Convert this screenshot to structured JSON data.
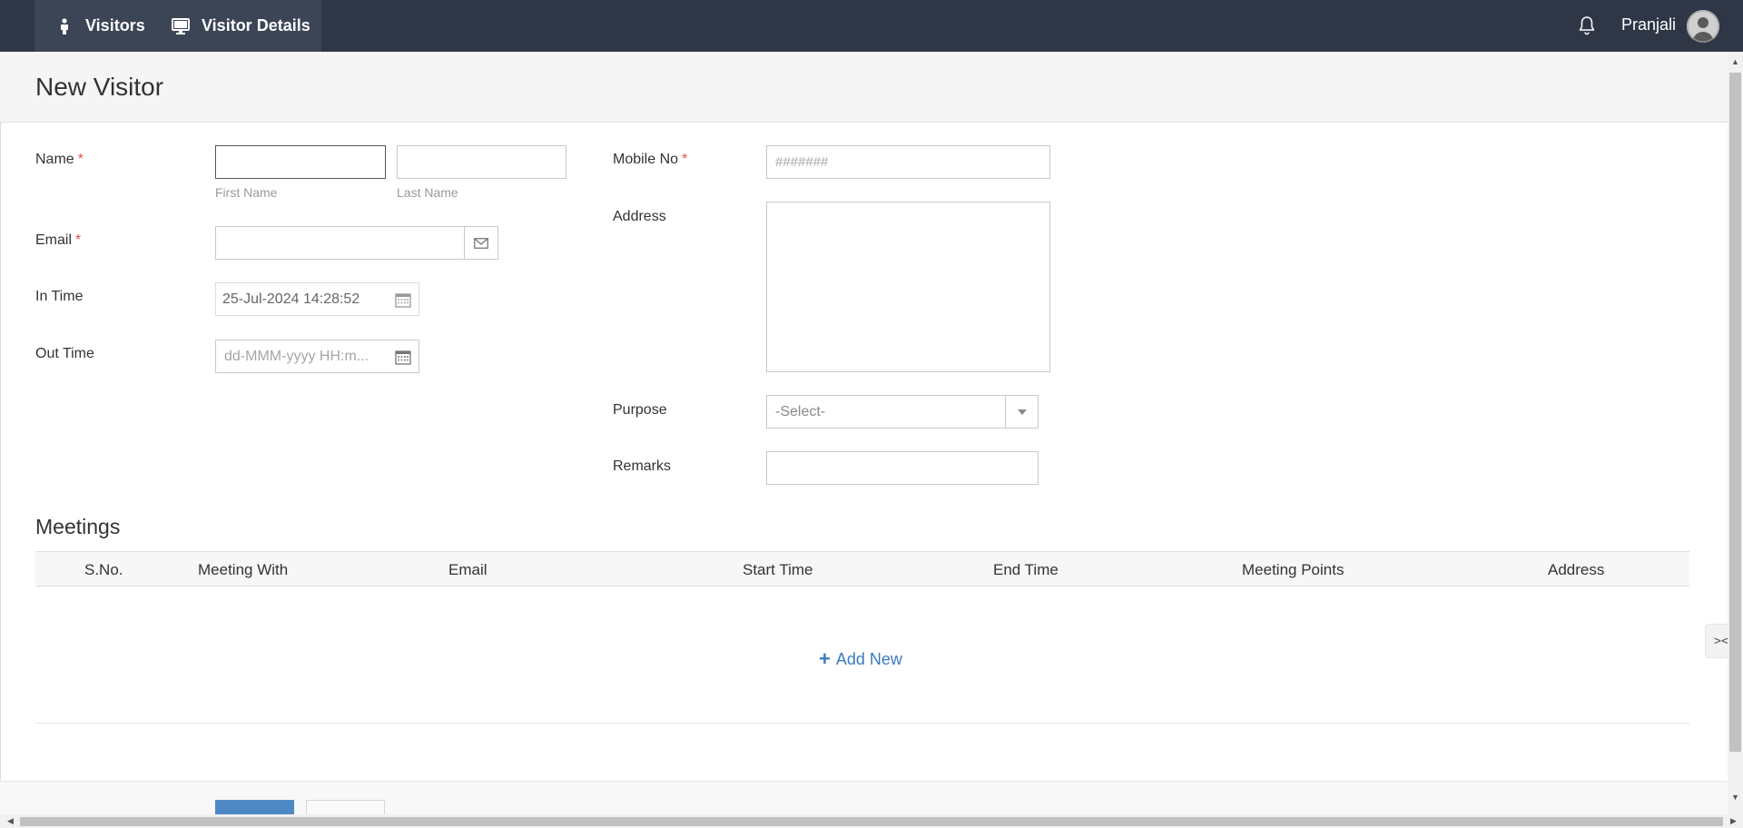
{
  "nav": {
    "tabs": [
      {
        "label": "Visitors",
        "icon": "person-icon"
      },
      {
        "label": "Visitor Details",
        "icon": "monitor-icon"
      }
    ],
    "username": "Pranjali"
  },
  "page": {
    "title": "New Visitor"
  },
  "form": {
    "name_label": "Name",
    "required_mark": "*",
    "first_name_hint": "First Name",
    "last_name_hint": "Last Name",
    "first_name_value": "",
    "last_name_value": "",
    "email_label": "Email",
    "email_value": "",
    "in_time_label": "In Time",
    "in_time_value": "25-Jul-2024 14:28:52",
    "out_time_label": "Out Time",
    "out_time_placeholder": "dd-MMM-yyyy HH:m...",
    "mobile_label": "Mobile No",
    "mobile_placeholder": "#######",
    "address_label": "Address",
    "address_value": "",
    "purpose_label": "Purpose",
    "purpose_selected": "-Select-",
    "remarks_label": "Remarks",
    "remarks_value": ""
  },
  "meetings": {
    "title": "Meetings",
    "columns": [
      "S.No.",
      "Meeting With",
      "Email",
      "Start Time",
      "End Time",
      "Meeting Points",
      "Address"
    ],
    "rows": [],
    "add_new_label": "Add New"
  },
  "colors": {
    "topbar": "#2f3747",
    "topbar_active": "#3c4556",
    "primary_button": "#4f89c5",
    "link": "#3a7bbf",
    "required": "#d9534f"
  }
}
